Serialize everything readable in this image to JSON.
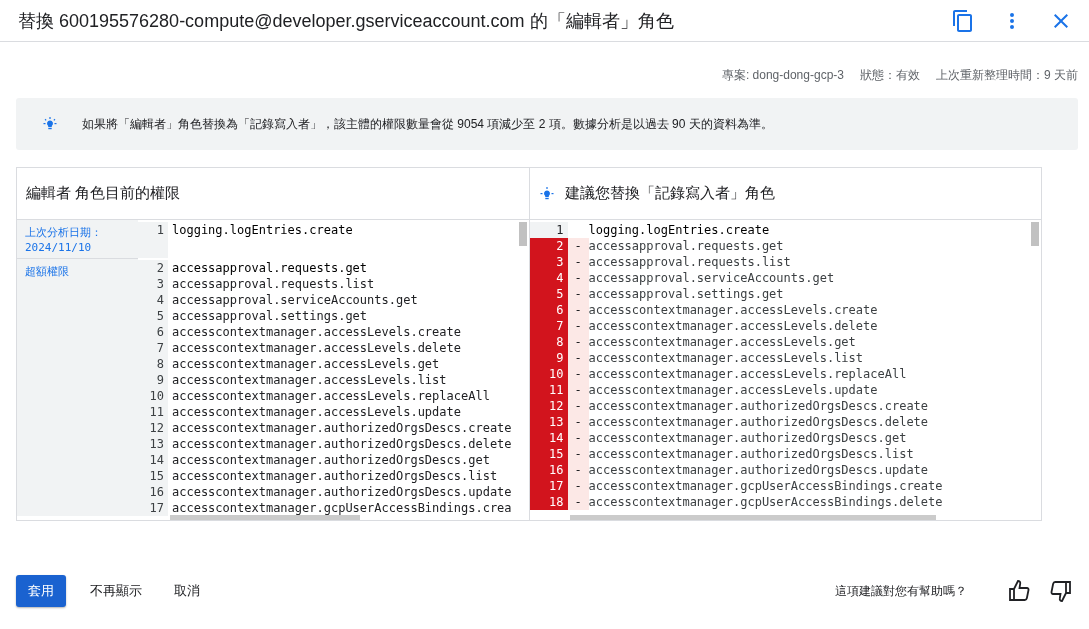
{
  "dialog": {
    "title": "替換 600195576280-compute@developer.gserviceaccount.com 的「編輯者」角色"
  },
  "meta": [
    "專案: dong-dong-gcp-3",
    "狀態：有效",
    "上次重新整理時間：9 天前"
  ],
  "banner": {
    "text": "如果將「編輯者」角色替換為「記錄寫入者」，該主體的權限數量會從 9054 項減少至 2 項。數據分析是以過去 90 天的資料為準。"
  },
  "current": {
    "title": "編輯者 角色目前的權限",
    "groups": [
      {
        "label": "上次分析日期：",
        "date": "2024/11/10",
        "lines": [
          {
            "num": "1",
            "text": "logging.logEntries.create"
          }
        ]
      },
      {
        "label": "超額權限",
        "lines": [
          {
            "num": "2",
            "text": "accessapproval.requests.get"
          },
          {
            "num": "3",
            "text": "accessapproval.requests.list"
          },
          {
            "num": "4",
            "text": "accessapproval.serviceAccounts.get"
          },
          {
            "num": "5",
            "text": "accessapproval.settings.get"
          },
          {
            "num": "6",
            "text": "accesscontextmanager.accessLevels.create"
          },
          {
            "num": "7",
            "text": "accesscontextmanager.accessLevels.delete"
          },
          {
            "num": "8",
            "text": "accesscontextmanager.accessLevels.get"
          },
          {
            "num": "9",
            "text": "accesscontextmanager.accessLevels.list"
          },
          {
            "num": "10",
            "text": "accesscontextmanager.accessLevels.replaceAll"
          },
          {
            "num": "11",
            "text": "accesscontextmanager.accessLevels.update"
          },
          {
            "num": "12",
            "text": "accesscontextmanager.authorizedOrgsDescs.create"
          },
          {
            "num": "13",
            "text": "accesscontextmanager.authorizedOrgsDescs.delete"
          },
          {
            "num": "14",
            "text": "accesscontextmanager.authorizedOrgsDescs.get"
          },
          {
            "num": "15",
            "text": "accesscontextmanager.authorizedOrgsDescs.list"
          },
          {
            "num": "16",
            "text": "accesscontextmanager.authorizedOrgsDescs.update"
          },
          {
            "num": "17",
            "text": "accesscontextmanager.gcpUserAccessBindings.crea"
          }
        ]
      }
    ]
  },
  "suggested": {
    "title": "建議您替換「記錄寫入者」角色",
    "lines": [
      {
        "num": "1",
        "removed": false,
        "text": "logging.logEntries.create"
      },
      {
        "num": "2",
        "removed": true,
        "mark": "-",
        "text": "accessapproval.requests.get"
      },
      {
        "num": "3",
        "removed": true,
        "mark": "-",
        "text": "accessapproval.requests.list"
      },
      {
        "num": "4",
        "removed": true,
        "mark": "-",
        "text": "accessapproval.serviceAccounts.get"
      },
      {
        "num": "5",
        "removed": true,
        "mark": "-",
        "text": "accessapproval.settings.get"
      },
      {
        "num": "6",
        "removed": true,
        "mark": "-",
        "text": "accesscontextmanager.accessLevels.create"
      },
      {
        "num": "7",
        "removed": true,
        "mark": "-",
        "text": "accesscontextmanager.accessLevels.delete"
      },
      {
        "num": "8",
        "removed": true,
        "mark": "-",
        "text": "accesscontextmanager.accessLevels.get"
      },
      {
        "num": "9",
        "removed": true,
        "mark": "-",
        "text": "accesscontextmanager.accessLevels.list"
      },
      {
        "num": "10",
        "removed": true,
        "mark": "-",
        "text": "accesscontextmanager.accessLevels.replaceAll"
      },
      {
        "num": "11",
        "removed": true,
        "mark": "-",
        "text": "accesscontextmanager.accessLevels.update"
      },
      {
        "num": "12",
        "removed": true,
        "mark": "-",
        "text": "accesscontextmanager.authorizedOrgsDescs.create"
      },
      {
        "num": "13",
        "removed": true,
        "mark": "-",
        "text": "accesscontextmanager.authorizedOrgsDescs.delete"
      },
      {
        "num": "14",
        "removed": true,
        "mark": "-",
        "text": "accesscontextmanager.authorizedOrgsDescs.get"
      },
      {
        "num": "15",
        "removed": true,
        "mark": "-",
        "text": "accesscontextmanager.authorizedOrgsDescs.list"
      },
      {
        "num": "16",
        "removed": true,
        "mark": "-",
        "text": "accesscontextmanager.authorizedOrgsDescs.update"
      },
      {
        "num": "17",
        "removed": true,
        "mark": "-",
        "text": "accesscontextmanager.gcpUserAccessBindings.create"
      },
      {
        "num": "18",
        "removed": true,
        "mark": "-",
        "text": "accesscontextmanager.gcpUserAccessBindings.delete"
      }
    ]
  },
  "footer": {
    "buttons": [
      {
        "label": "套用",
        "kind": "primary"
      },
      {
        "label": "不再顯示",
        "kind": "text"
      },
      {
        "label": "取消",
        "kind": "text"
      }
    ],
    "feedback": "這項建議對您有幫助嗎？"
  }
}
